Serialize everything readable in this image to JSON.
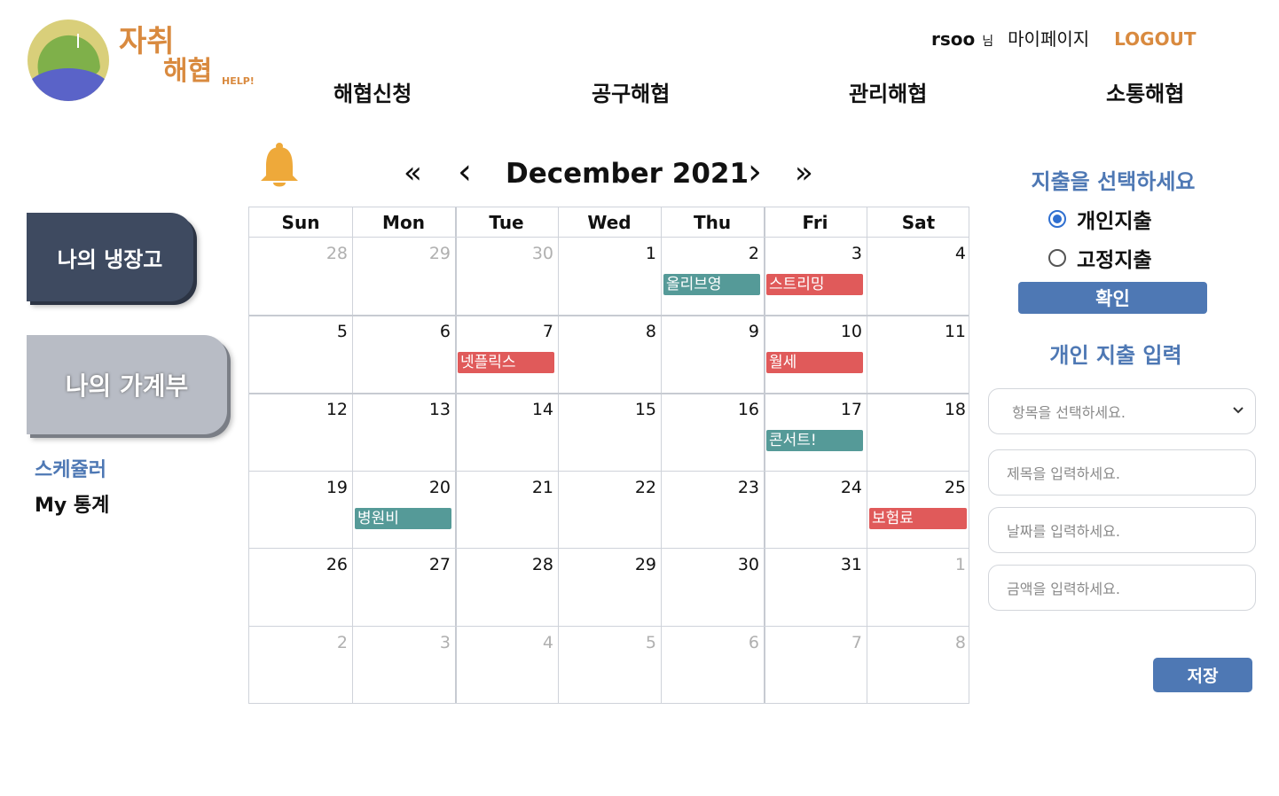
{
  "logo": {
    "line1": "자취",
    "line2": "해협",
    "tag": "HELP!"
  },
  "header": {
    "username": "rsoo",
    "honorific": "님",
    "mypage": "마이페이지",
    "logout": "LOGOUT",
    "logout_color": "#d98a3f"
  },
  "nav": [
    {
      "label": "해협신청"
    },
    {
      "label": "공구해협"
    },
    {
      "label": "관리해협"
    },
    {
      "label": "소통해협"
    }
  ],
  "sidebar": {
    "fridge": "나의 냉장고",
    "ledger": "나의 가계부",
    "scheduler": "스케쥴러",
    "stats": "My 통계"
  },
  "calendar": {
    "title": "December 2021",
    "prev_year": "«",
    "prev_month": "‹",
    "next_month": "›",
    "next_year": "»",
    "weekdays": [
      "Sun",
      "Mon",
      "Tue",
      "Wed",
      "Thu",
      "Fri",
      "Sat"
    ],
    "weeks": [
      [
        "28",
        "29",
        "30",
        "1",
        "2",
        "3",
        "4"
      ],
      [
        "5",
        "6",
        "7",
        "8",
        "9",
        "10",
        "11"
      ],
      [
        "12",
        "13",
        "14",
        "15",
        "16",
        "17",
        "18"
      ],
      [
        "19",
        "20",
        "21",
        "22",
        "23",
        "24",
        "25"
      ],
      [
        "26",
        "27",
        "28",
        "29",
        "30",
        "31",
        "1"
      ],
      [
        "2",
        "3",
        "4",
        "5",
        "6",
        "7",
        "8"
      ]
    ],
    "events": [
      {
        "date": "2021-12-02",
        "title": "올리브영",
        "kind": "teal"
      },
      {
        "date": "2021-12-03",
        "title": "스트리밍",
        "kind": "red"
      },
      {
        "date": "2021-12-07",
        "title": "넷플릭스",
        "kind": "red"
      },
      {
        "date": "2021-12-10",
        "title": "월세",
        "kind": "red"
      },
      {
        "date": "2021-12-17",
        "title": "콘서트!",
        "kind": "teal"
      },
      {
        "date": "2021-12-20",
        "title": "병원비",
        "kind": "teal"
      },
      {
        "date": "2021-12-25",
        "title": "보험료",
        "kind": "red"
      }
    ],
    "event_colors": {
      "teal": "#559a98",
      "red": "#e05a5a"
    }
  },
  "expense_panel": {
    "title": "지출을 선택하세요",
    "options": [
      "개인지출",
      "고정지출"
    ],
    "selected": "개인지출",
    "confirm": "확인",
    "form_title": "개인 지출 입력",
    "category_placeholder": "항목을 선택하세요.",
    "title_placeholder": "제목을 입력하세요.",
    "date_placeholder": "날짜를 입력하세요.",
    "amount_placeholder": "금액을 입력하세요.",
    "save": "저장",
    "accent_color": "#4e78b4"
  }
}
